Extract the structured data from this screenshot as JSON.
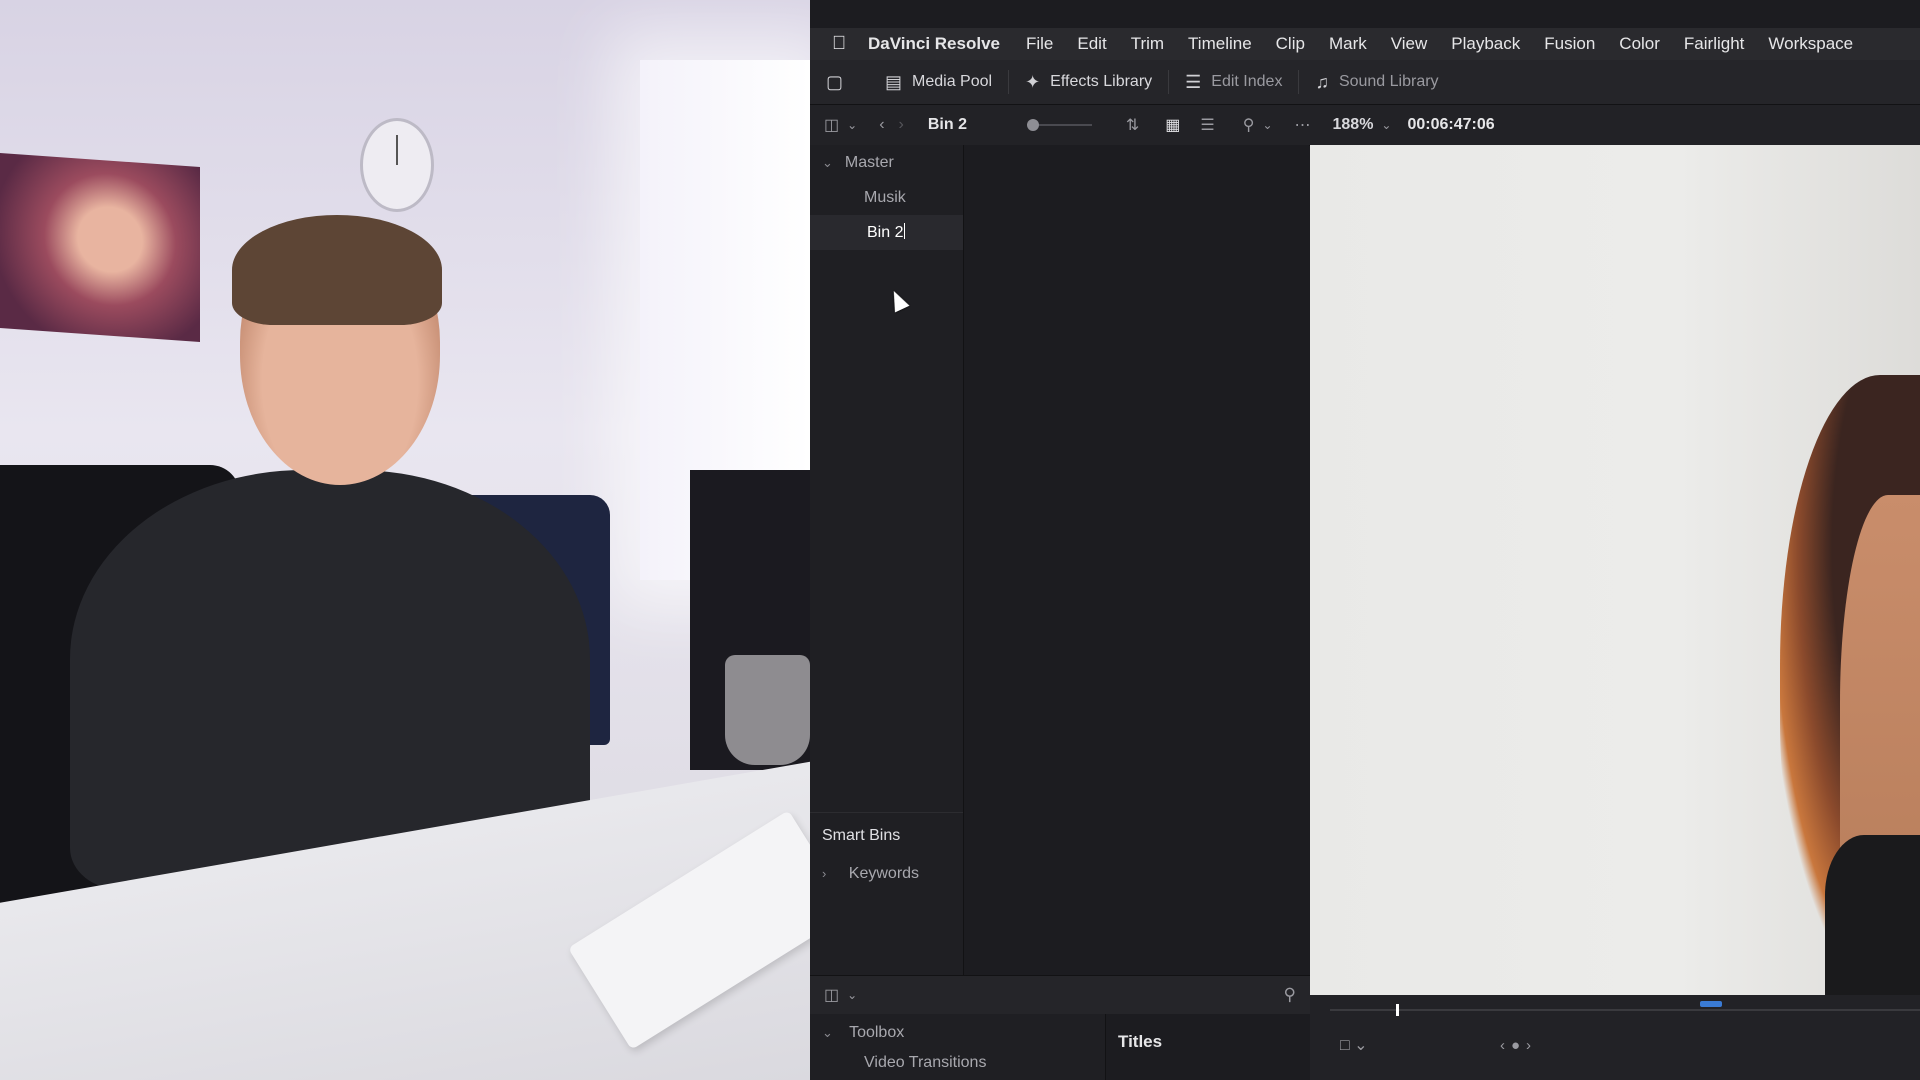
{
  "menubar": {
    "app_name": "DaVinci Resolve",
    "items": [
      "File",
      "Edit",
      "Trim",
      "Timeline",
      "Clip",
      "Mark",
      "View",
      "Playback",
      "Fusion",
      "Color",
      "Fairlight",
      "Workspace"
    ]
  },
  "toolbar": {
    "media_pool": "Media Pool",
    "effects_library": "Effects Library",
    "edit_index": "Edit Index",
    "sound_library": "Sound Library"
  },
  "subbar": {
    "bin_title": "Bin 2",
    "zoom": "188%",
    "timecode": "00:06:47:06"
  },
  "bins": {
    "master": "Master",
    "items": [
      {
        "label": "Musik"
      },
      {
        "label": "Bin 2"
      }
    ]
  },
  "smart_bins": {
    "title": "Smart Bins",
    "keywords": "Keywords"
  },
  "toolbox": {
    "title": "Toolbox",
    "sub_item": "Video Transitions"
  },
  "titles_panel": {
    "title": "Titles"
  },
  "icons": {
    "apple": "apple-icon",
    "monitor": "monitor-icon",
    "media_pool": "media-pool-icon",
    "effects": "magic-wand-icon",
    "edit_index": "list-icon",
    "sound_library": "music-icon"
  },
  "colors": {
    "panel_bg": "#1c1c20",
    "accent_blue": "#3a7bd5",
    "text": "#c8c8cc"
  }
}
